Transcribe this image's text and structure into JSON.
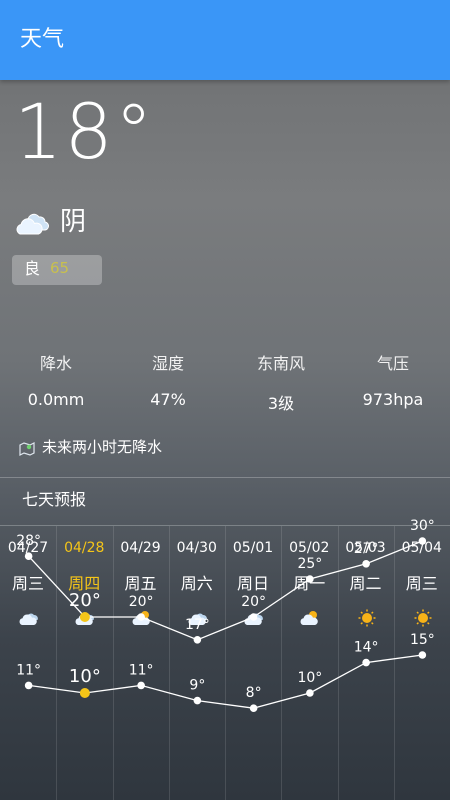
{
  "app": {
    "title": "天气"
  },
  "current": {
    "temperature": "18°",
    "condition": "阴",
    "condition_icon": "cloudy-icon",
    "aqi_label": "良",
    "aqi_value": "65",
    "aqi_color": "#c9c04d"
  },
  "stats": [
    {
      "label": "降水",
      "value": "0.0mm"
    },
    {
      "label": "湿度",
      "value": "47%"
    },
    {
      "label": "东南风",
      "value": "3级"
    },
    {
      "label": "气压",
      "value": "973hpa"
    }
  ],
  "rain_notice": "未来两小时无降水",
  "forecast": {
    "title": "七天预报",
    "today_color": "#f5c518",
    "days": [
      {
        "date": "04/27",
        "weekday": "周三",
        "icon": "cloudy-icon",
        "high": 28,
        "low": 11,
        "high_label": "28°",
        "low_label": "11°",
        "today": false
      },
      {
        "date": "04/28",
        "weekday": "周四",
        "icon": "cloudy-icon",
        "high": 20,
        "low": 10,
        "high_label": "20°",
        "low_label": "10°",
        "today": true
      },
      {
        "date": "04/29",
        "weekday": "周五",
        "icon": "partly-cloudy-icon",
        "high": 20,
        "low": 11,
        "high_label": "20°",
        "low_label": "11°",
        "today": false
      },
      {
        "date": "04/30",
        "weekday": "周六",
        "icon": "cloudy-icon",
        "high": 17,
        "low": 9,
        "high_label": "17°",
        "low_label": "9°",
        "today": false
      },
      {
        "date": "05/01",
        "weekday": "周日",
        "icon": "cloudy-icon",
        "high": 20,
        "low": 8,
        "high_label": "20°",
        "low_label": "8°",
        "today": false
      },
      {
        "date": "05/02",
        "weekday": "周一",
        "icon": "partly-cloudy-icon",
        "high": 25,
        "low": 10,
        "high_label": "25°",
        "low_label": "10°",
        "today": false
      },
      {
        "date": "05/03",
        "weekday": "周二",
        "icon": "sunny-icon",
        "high": 27,
        "low": 14,
        "high_label": "27°",
        "low_label": "14°",
        "today": false
      },
      {
        "date": "05/04",
        "weekday": "周三",
        "icon": "sunny-icon",
        "high": 30,
        "low": 15,
        "high_label": "30°",
        "low_label": "15°",
        "today": false
      }
    ]
  }
}
